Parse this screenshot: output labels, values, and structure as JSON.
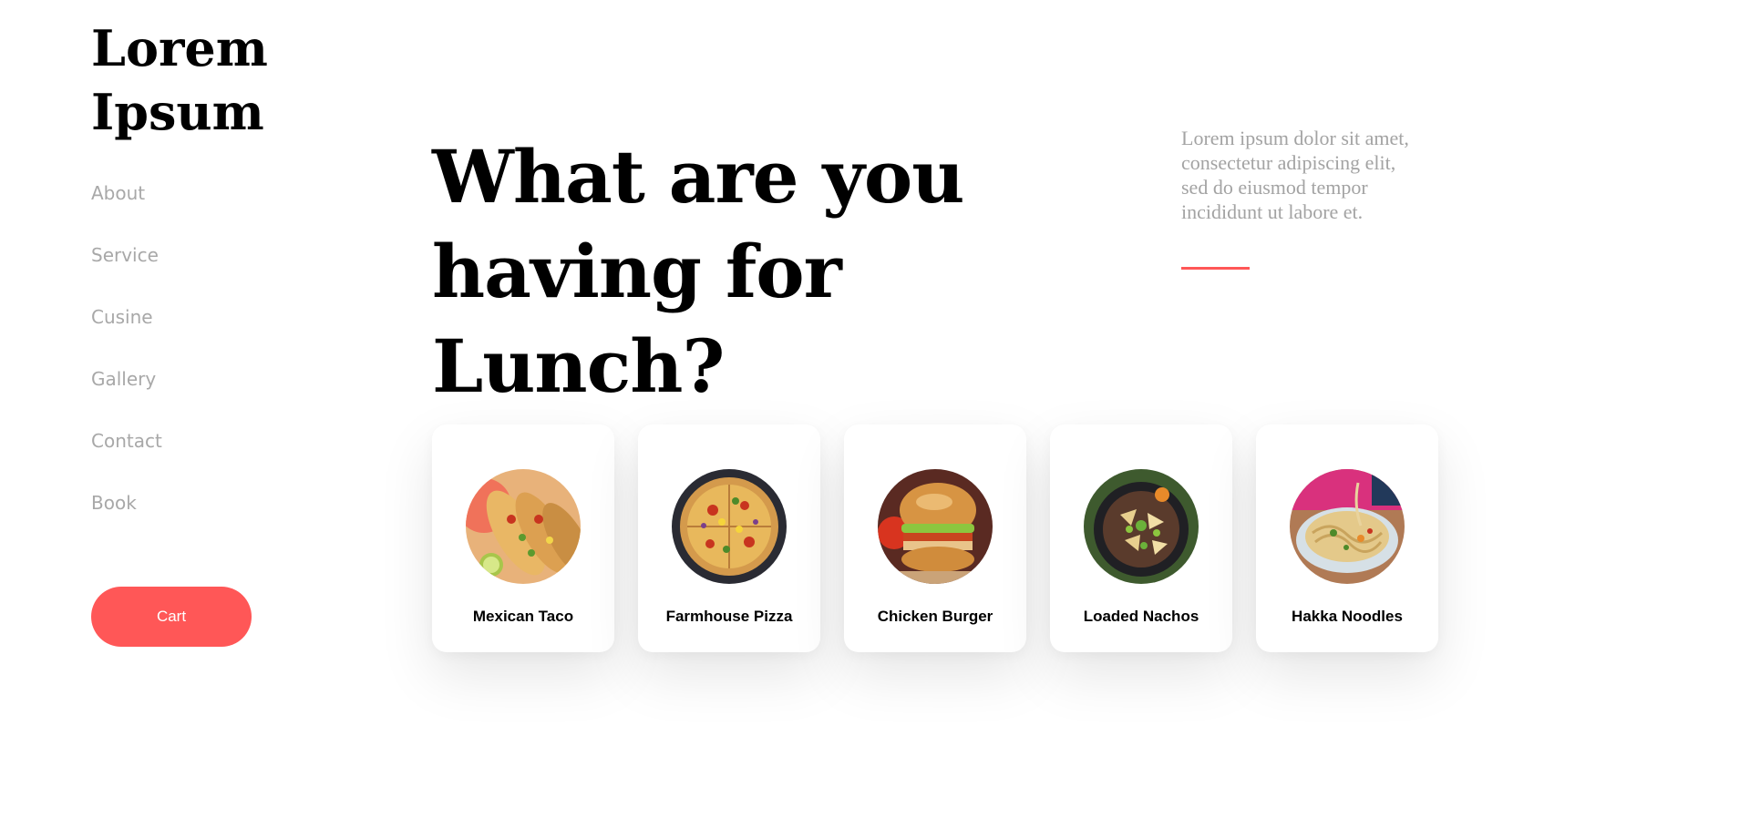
{
  "brand": {
    "line1": "Lorem",
    "line2": "Ipsum"
  },
  "nav": {
    "items": [
      {
        "label": "About"
      },
      {
        "label": "Service"
      },
      {
        "label": "Cusine"
      },
      {
        "label": "Gallery"
      },
      {
        "label": "Contact"
      },
      {
        "label": "Book"
      }
    ]
  },
  "cart": {
    "label": "Cart"
  },
  "hero": {
    "title_line1": "What are you",
    "title_line2": "having for Lunch?",
    "intro": "Lorem ipsum dolor sit amet, consectetur adipiscing elit, sed do eiusmod tempor incididunt ut labore et."
  },
  "colors": {
    "accent": "#ff5757",
    "muted": "#a8a8a8"
  },
  "dishes": [
    {
      "name": "Mexican Taco",
      "image": "taco-image"
    },
    {
      "name": "Farmhouse Pizza",
      "image": "pizza-image"
    },
    {
      "name": "Chicken Burger",
      "image": "burger-image"
    },
    {
      "name": "Loaded Nachos",
      "image": "nachos-image"
    },
    {
      "name": "Hakka Noodles",
      "image": "noodles-image"
    }
  ]
}
